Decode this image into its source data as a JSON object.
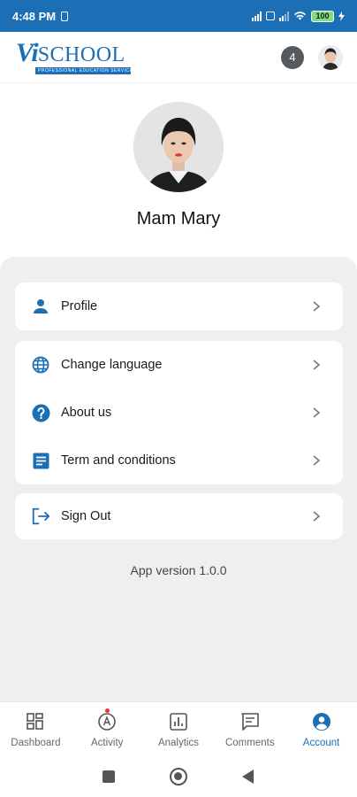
{
  "status_bar": {
    "time": "4:48 PM",
    "battery": "100"
  },
  "header": {
    "logo_vi": "Vi",
    "logo_school": "SCHOOL",
    "logo_tagline": "PROFESSIONAL EDUCATION SERVICE",
    "notification_count": "4"
  },
  "profile": {
    "name": "Mam Mary"
  },
  "menu": {
    "profile_label": "Profile",
    "change_language_label": "Change language",
    "about_us_label": "About us",
    "terms_label": "Term and conditions",
    "sign_out_label": "Sign Out"
  },
  "app_version": "App version 1.0.0",
  "bottom_nav": {
    "dashboard": "Dashboard",
    "activity": "Activity",
    "analytics": "Analytics",
    "comments": "Comments",
    "account": "Account",
    "active": "Account"
  },
  "colors": {
    "brand": "#1c6fb4",
    "panel_bg": "#efefef",
    "badge": "#555a5f",
    "alert_dot": "#e53935"
  },
  "icons": [
    "person-icon",
    "globe-icon",
    "help-circle-icon",
    "document-icon",
    "sign-out-icon",
    "chevron-right-icon",
    "dashboard-icon",
    "activity-icon",
    "analytics-icon",
    "comments-icon",
    "account-icon"
  ]
}
